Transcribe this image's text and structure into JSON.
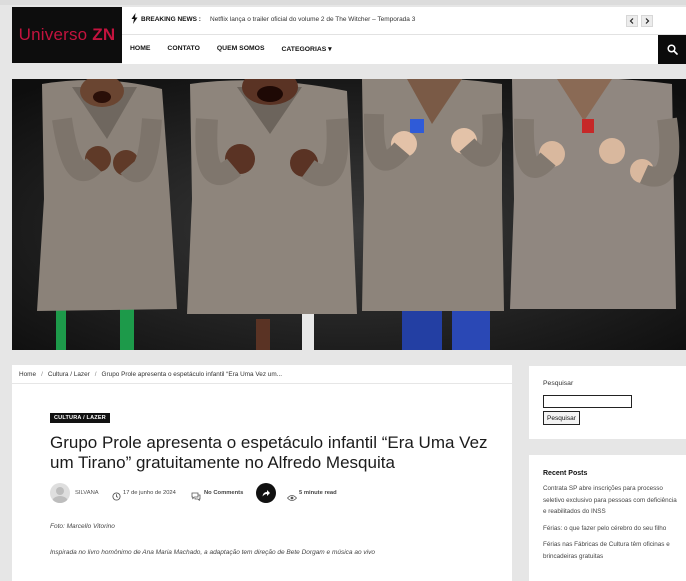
{
  "brand": {
    "logo_part1": "Universo ",
    "logo_part2": "ZN",
    "logo_color": "#c3133e"
  },
  "breaking": {
    "label": "BREAKING NEWS :",
    "headline": "Netflix lança o trailer oficial do volume 2 de The Witcher – Temporada 3",
    "prev_icon": "chevron-left-icon",
    "next_icon": "chevron-right-icon"
  },
  "nav": {
    "items": [
      "HOME",
      "CONTATO",
      "QUEM SOMOS",
      "CATEGORIAS ▾"
    ],
    "search_icon": "search-icon"
  },
  "hero": {
    "description_icon": "performers-photo"
  },
  "breadcrumb": {
    "items": [
      "Home",
      "Cultura / Lazer",
      "Grupo Prole apresenta o espetáculo infantil “Era Uma Vez um..."
    ],
    "separator": "/"
  },
  "article": {
    "category": "CULTURA / LAZER",
    "title": "Grupo Prole apresenta o espetáculo infantil “Era Uma Vez um Tirano” gratuitamente no Alfredo Mesquita",
    "author": "SILVANA",
    "date": "17 de junho de 2024",
    "comments": "No Comments",
    "read_time": "5 minute read",
    "photo_credit": "Foto: Marcello Vitorino",
    "intro": "Inspirada no livro homônimo de Ana Maria Machado, a adaptação tem direção de Bete Dorgam e música ao vivo"
  },
  "sidebar": {
    "search_label": "Pesquisar",
    "search_value": "",
    "search_button": "Pesquisar",
    "recent_title": "Recent Posts",
    "recent_posts": [
      "Contrata SP abre inscrições para processo seletivo exclusivo para pessoas com deficiência e reabilitados do INSS",
      "Férias: o que fazer pelo cérebro do seu filho",
      "Férias nas Fábricas de Cultura têm oficinas e brincadeiras gratuitas"
    ]
  }
}
